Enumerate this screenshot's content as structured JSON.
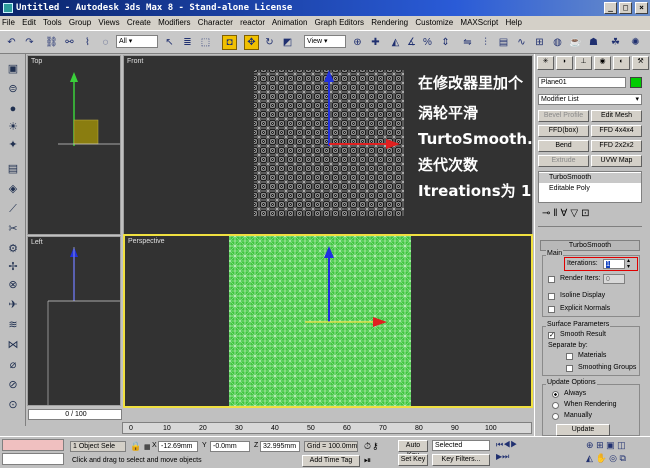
{
  "window": {
    "title": "Untitled - Autodesk 3ds Max 8 - Stand-alone License"
  },
  "menu": [
    "File",
    "Edit",
    "Tools",
    "Group",
    "Views",
    "Create",
    "Modifiers",
    "Character",
    "reactor",
    "Animation",
    "Graph Editors",
    "Rendering",
    "Customize",
    "MAXScript",
    "Help"
  ],
  "toolbar": {
    "selection_filter": "All",
    "ref_coord": "View"
  },
  "viewports": {
    "top": "Top",
    "front": "Front",
    "left": "Left",
    "perspective": "Perspective"
  },
  "annotation": [
    "在修改器里加个",
    "涡轮平滑",
    "TurtoSmooth.",
    "迭代次数",
    "Itreations为 1"
  ],
  "command_panel": {
    "object_name": "Plane01",
    "modifier_list": "Modifier List",
    "buttons": [
      "Bevel Profile",
      "Edit Mesh",
      "FFD(box)",
      "FFD 4x4x4",
      "Bend",
      "FFD 2x2x2",
      "Extrude",
      "UVW Map"
    ],
    "stack": [
      "TurboSmooth",
      "Editable Poly"
    ],
    "rollout_title": "TurboSmooth",
    "main_group": "Main",
    "iterations_label": "Iterations:",
    "iterations_value": "1",
    "render_iters_label": "Render Iters:",
    "render_iters_value": "0",
    "isoline_label": "Isoline Display",
    "explicit_label": "Explicit Normals",
    "surface_group": "Surface Parameters",
    "smooth_result": "Smooth Result",
    "separate_by": "Separate by:",
    "materials": "Materials",
    "smoothing_groups": "Smoothing Groups",
    "update_group": "Update Options",
    "always": "Always",
    "when_rendering": "When Rendering",
    "manually": "Manually",
    "update_btn": "Update"
  },
  "timeline": {
    "frame": "0 / 100",
    "ticks": [
      "0",
      "10",
      "20",
      "30",
      "40",
      "50",
      "60",
      "70",
      "80",
      "90",
      "100"
    ]
  },
  "status": {
    "selected": "1 Object Sele",
    "x_label": "X",
    "x": "-12.69mm",
    "y_label": "Y",
    "y": "-0.0mm",
    "z_label": "Z",
    "z": "32.995mm",
    "grid": "Grid = 100.0mm",
    "auto_key": "Auto Key",
    "selected_dd": "Selected",
    "set_key": "Set Key",
    "key_filters": "Key Filters...",
    "add_time_tag": "Add Time Tag",
    "prompt": "Click and drag to select and move objects"
  },
  "colors": {
    "viewport_bg": "#323232",
    "mesh_green": "#3fc63f",
    "annotation_text": "#ffffff",
    "active_border": "#f0e040",
    "highlight_red": "#e00000"
  }
}
